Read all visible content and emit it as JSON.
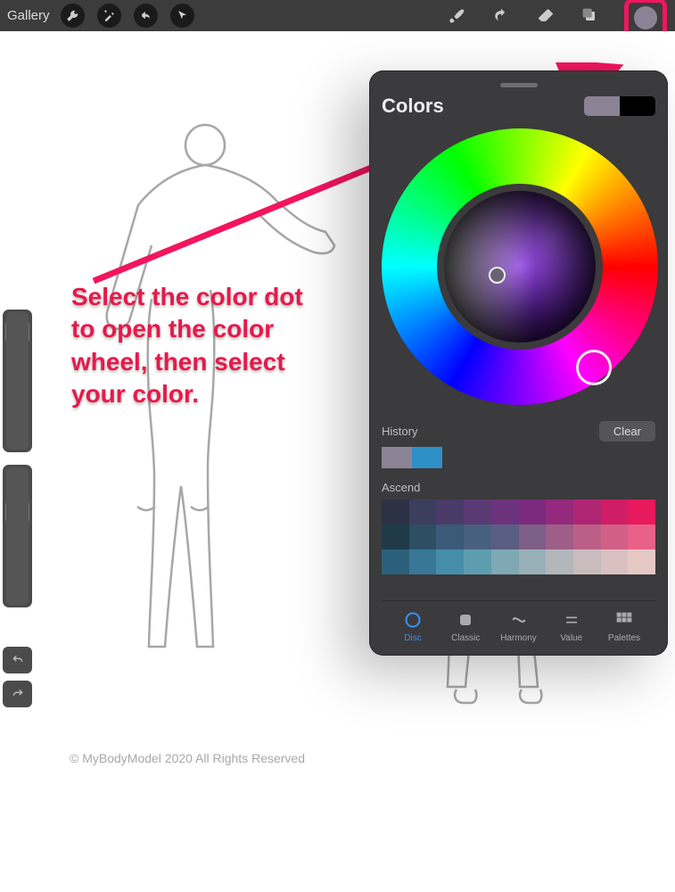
{
  "toolbar": {
    "gallery_label": "Gallery"
  },
  "annotation": {
    "text": "Select the color dot to open the color wheel, then select your color."
  },
  "color_panel": {
    "title": "Colors",
    "current_swatch": "#8b8395",
    "secondary_swatch": "#000000",
    "history_label": "History",
    "clear_label": "Clear",
    "history": [
      "#8b8395",
      "#2f8fc7"
    ],
    "palette_label": "Ascend",
    "palette_rows": [
      [
        "#2c3244",
        "#3b3e5e",
        "#4a3a69",
        "#5a3a73",
        "#6b337c",
        "#7c2a7d",
        "#932a7d",
        "#b02673",
        "#cf1e66",
        "#e61a5c"
      ],
      [
        "#203a4a",
        "#2d4e63",
        "#3a5a77",
        "#48607f",
        "#5a5e82",
        "#7c5e86",
        "#9d5f87",
        "#bb5f87",
        "#d15f86",
        "#e86189"
      ],
      [
        "#2c607a",
        "#387795",
        "#468daa",
        "#5e9db0",
        "#7ea9b4",
        "#9ab0b8",
        "#b3b6ba",
        "#c9bcbe",
        "#d9c1c1",
        "#e6c8c6"
      ]
    ],
    "tabs": [
      {
        "label": "Disc",
        "icon": "disc",
        "active": true
      },
      {
        "label": "Classic",
        "icon": "classic",
        "active": false
      },
      {
        "label": "Harmony",
        "icon": "harmony",
        "active": false
      },
      {
        "label": "Value",
        "icon": "value",
        "active": false
      },
      {
        "label": "Palettes",
        "icon": "palettes",
        "active": false
      }
    ]
  },
  "copyright": "© MyBodyModel 2020 All Rights Reserved"
}
